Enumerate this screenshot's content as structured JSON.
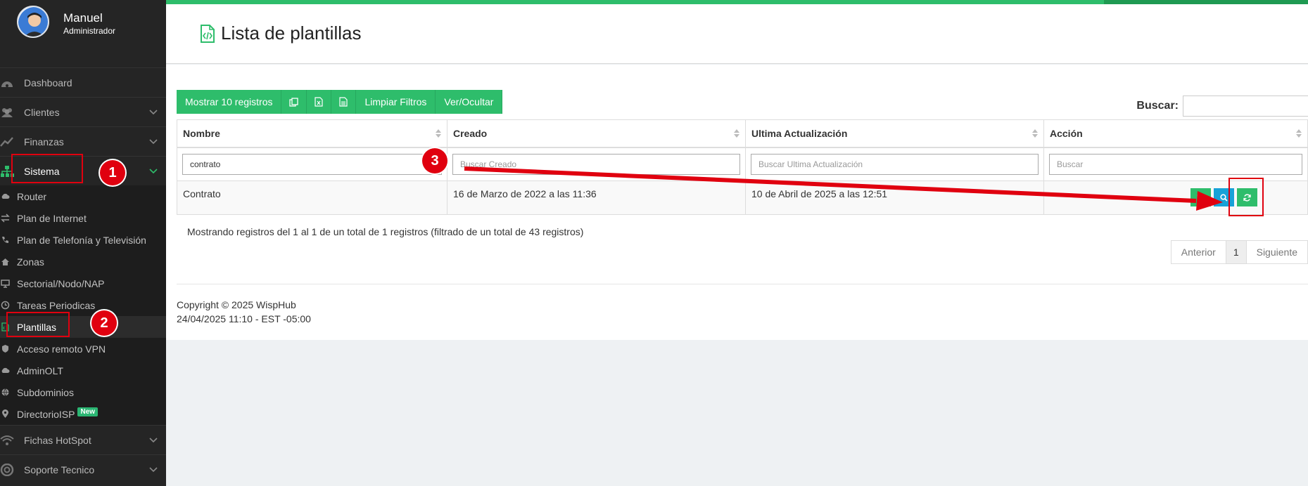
{
  "user": {
    "name": "Manuel",
    "role": "Administrador"
  },
  "menu": [
    {
      "label": "Dashboard",
      "icon": "dashboard-icon",
      "chevron": false
    },
    {
      "label": "Clientes",
      "icon": "users-icon",
      "chevron": true
    },
    {
      "label": "Finanzas",
      "icon": "chart-line-icon",
      "chevron": true
    },
    {
      "label": "Sistema",
      "icon": "sitemap-icon",
      "chevron": true,
      "active": true
    }
  ],
  "submenu": [
    {
      "label": "Router",
      "icon": "cloud-icon"
    },
    {
      "label": "Plan de Internet",
      "icon": "exchange-icon"
    },
    {
      "label": "Plan de Telefonía y Televisión",
      "icon": "phone-icon"
    },
    {
      "label": "Zonas",
      "icon": "home-icon"
    },
    {
      "label": "Sectorial/Nodo/NAP",
      "icon": "desktop-icon"
    },
    {
      "label": "Tareas Periodicas",
      "icon": "clock-icon"
    },
    {
      "label": "Plantillas",
      "icon": "file-code-icon",
      "active": true
    },
    {
      "label": "Acceso remoto VPN",
      "icon": "shield-icon"
    },
    {
      "label": "AdminOLT",
      "icon": "cloud-icon"
    },
    {
      "label": "Subdominios",
      "icon": "globe-icon"
    },
    {
      "label": "DirectorioISP",
      "icon": "map-marker-icon",
      "badge": "New"
    }
  ],
  "menu_bottom": [
    {
      "label": "Fichas HotSpot",
      "icon": "wifi-icon",
      "chevron": true
    },
    {
      "label": "Soporte Tecnico",
      "icon": "life-ring-icon",
      "chevron": true
    }
  ],
  "page": {
    "title": "Lista de plantillas"
  },
  "toolbar": {
    "show_records": "Mostrar 10 registros",
    "clear_filters": "Limpiar Filtros",
    "toggle_columns": "Ver/Ocultar"
  },
  "search": {
    "label": "Buscar:"
  },
  "table": {
    "columns": [
      "Nombre",
      "Creado",
      "Ultima Actualización",
      "Acción"
    ],
    "filters": {
      "nombre_value": "contrato",
      "creado_placeholder": "Buscar Creado",
      "actualizacion_placeholder": "Buscar Ultima Actualización",
      "accion_placeholder": "Buscar"
    },
    "rows": [
      {
        "nombre": "Contrato",
        "creado": "16 de Marzo de 2022 a las 11:36",
        "actualizacion": "10 de Abril de 2025 a las 12:51"
      }
    ]
  },
  "info": "Mostrando registros del 1 al 1 de un total de 1 registros (filtrado de un total de 43 registros)",
  "pagination": {
    "prev": "Anterior",
    "current": "1",
    "next": "Siguiente"
  },
  "footer": {
    "copyright": "Copyright © 2025 WispHub",
    "datetime": "24/04/2025 11:10 - EST -05:00"
  },
  "annotations": [
    "1",
    "2",
    "3"
  ],
  "colors": {
    "accent": "#2ebd6b",
    "info": "#17a2d8",
    "annotation": "#e0000f",
    "sidebar": "#252525"
  }
}
